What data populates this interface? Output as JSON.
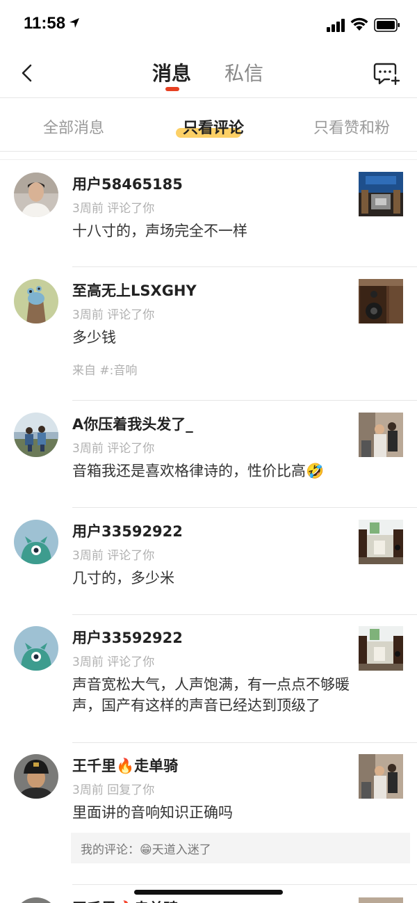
{
  "status_bar": {
    "time": "11:58"
  },
  "nav": {
    "tab_messages": "消息",
    "tab_dms": "私信"
  },
  "filters": {
    "all": "全部消息",
    "comments_only": "只看评论",
    "likes_only": "只看赞和粉"
  },
  "items": [
    {
      "name": "用户58465185",
      "meta": "3周前 评论了你",
      "text": "十八寸的，声场完全不一样"
    },
    {
      "name": "至高无上LSXGHY",
      "meta": "3周前 评论了你",
      "text": "多少钱",
      "source": "来自 #:音响"
    },
    {
      "name": "A你压着我头发了_",
      "meta": "3周前 评论了你",
      "text": "音箱我还是喜欢格律诗的，性价比高🤣"
    },
    {
      "name": "用户33592922",
      "meta": "3周前 评论了你",
      "text": "几寸的，多少米"
    },
    {
      "name": "用户33592922",
      "meta": "3周前 评论了你",
      "text": "声音宽松大气，人声饱满，有一点点不够暖声，国产有这样的声音已经达到顶级了"
    },
    {
      "name": "王千里🔥走单骑",
      "meta": "3周前 回复了你",
      "text": "里面讲的音响知识正确吗",
      "quote": "我的评论：😁天道入迷了"
    },
    {
      "name": "王千里🔥走单骑"
    }
  ]
}
